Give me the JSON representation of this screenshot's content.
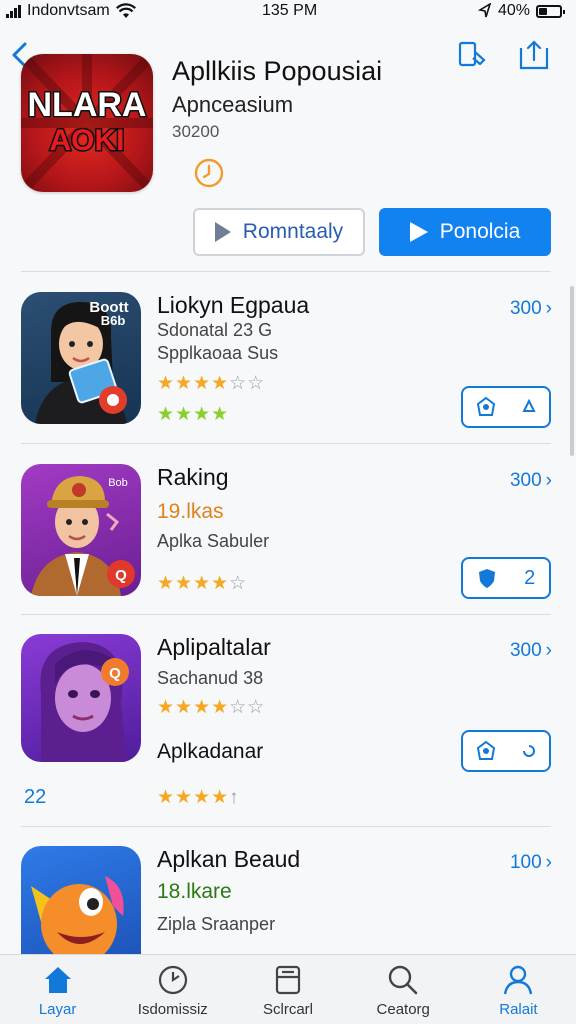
{
  "status_bar": {
    "carrier": "Indonvtsam",
    "time": "135 PM",
    "battery": "40%",
    "battery_level": 0.4
  },
  "hero": {
    "icon_text_top": "NLARA",
    "icon_text_mid": "AOKI",
    "title": "Apllkiis Popousiai",
    "subtitle": "Apnceasium",
    "count": "30200",
    "secondary_button": "Romntaaly",
    "primary_button": "Ponolcia"
  },
  "rows": [
    {
      "title": "Liokyn Egpaua",
      "line1": "Sdonatal 23 G",
      "line2": "Spplkaoaa Sus",
      "size": "300",
      "icon_badge": "Boott\nB6b",
      "rating": 3.5,
      "rating_green": 4,
      "button_right": ""
    },
    {
      "title": "Raking",
      "line1": "19.lkas",
      "line2": "Aplka Sabuler",
      "size": "300",
      "icon_badge": "Bob",
      "rating": 4,
      "button_right": "2"
    },
    {
      "title": "Aplipaltalar",
      "line1": "Sachanud 38",
      "line2": "Aplkadanar",
      "size": "300",
      "rating": 3.5,
      "rating2": 4,
      "left_number": "22",
      "button_right": ""
    },
    {
      "title": "Aplkan Beaud",
      "line1": "18.lkare",
      "line2": "Zipla Sraanper",
      "size": "100"
    }
  ],
  "tabs": [
    {
      "label": "Layar",
      "icon": "home-icon",
      "active": true
    },
    {
      "label": "Isdomissiz",
      "icon": "clock-icon",
      "active": false
    },
    {
      "label": "Sclrcarl",
      "icon": "printer-icon",
      "active": false
    },
    {
      "label": "Ceatorg",
      "icon": "search-icon",
      "active": false
    },
    {
      "label": "Ralait",
      "icon": "person-icon",
      "active": true
    }
  ],
  "colors": {
    "accent": "#1379d9",
    "primary_button": "#1182f0",
    "star": "#f4a823",
    "star_green": "#8bcf2a",
    "orange_text": "#e0821a",
    "green_text": "#2c7a14"
  }
}
